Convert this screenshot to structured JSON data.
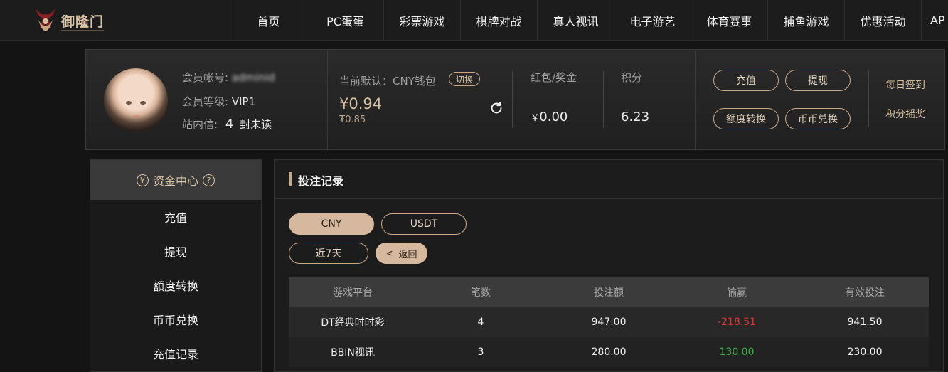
{
  "logo": {
    "text": "御隆门"
  },
  "nav": [
    "首页",
    "PC蛋蛋",
    "彩票游戏",
    "棋牌对战",
    "真人视讯",
    "电子游艺",
    "体育赛事",
    "捕鱼游戏",
    "优惠活动",
    "AP"
  ],
  "member": {
    "account_label": "会员帐号:",
    "account_value": "adminid",
    "level_label": "会员等级:",
    "level_value": "VIP1",
    "inbox_label": "站内信:",
    "inbox_count": "4",
    "inbox_unit": "封未读"
  },
  "wallet": {
    "default_label": "当前默认：CNY钱包",
    "switch_label": "切换",
    "balance": "¥0.94",
    "balance_sub": "₮0.85"
  },
  "stats": {
    "bonus_label": "红包/奖金",
    "bonus_currency": "¥",
    "bonus_value": "0.00",
    "points_label": "积分",
    "points_value": "6.23"
  },
  "actions": {
    "deposit": "充值",
    "withdraw": "提现",
    "transfer": "额度转换",
    "exchange": "币币兑换",
    "daily_checkin": "每日签到",
    "points_lottery": "积分摇奖"
  },
  "sidebar": {
    "title": "资金中心",
    "items": [
      "充值",
      "提现",
      "额度转换",
      "币币兑换",
      "充值记录"
    ]
  },
  "content": {
    "title": "投注记录",
    "currency_tabs": [
      "CNY",
      "USDT"
    ],
    "period": "近7天",
    "back": "返回",
    "table": {
      "headers": [
        "游戏平台",
        "笔数",
        "投注额",
        "输赢",
        "有效投注"
      ],
      "rows": [
        [
          "DT经典时时彩",
          "4",
          "947.00",
          "-218.51",
          "941.50"
        ],
        [
          "BBIN视讯",
          "3",
          "280.00",
          "130.00",
          "230.00"
        ]
      ]
    }
  },
  "colors": {
    "accent": "#d6b89e",
    "loss": "#e0363a",
    "win": "#3db04a"
  }
}
